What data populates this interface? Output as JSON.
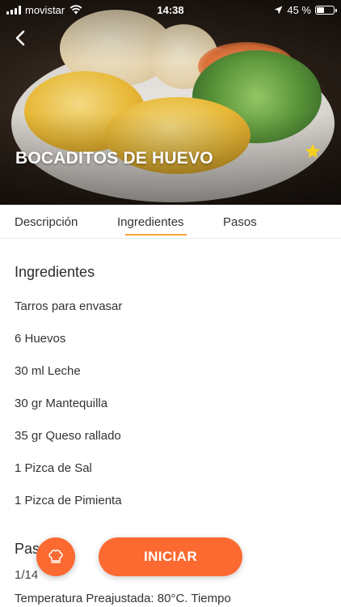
{
  "status_bar": {
    "carrier": "movistar",
    "time": "14:38",
    "battery": "45 %",
    "battery_level": 0.45
  },
  "recipe": {
    "title": "BOCADITOS DE HUEVO"
  },
  "tabs": [
    {
      "label": "Descripción",
      "active": false
    },
    {
      "label": "Ingredientes",
      "active": true
    },
    {
      "label": "Pasos",
      "active": false
    }
  ],
  "ingredients": {
    "title": "Ingredientes",
    "items": [
      "Tarros para envasar",
      "6 Huevos",
      "30 ml Leche",
      "30 gr Mantequilla",
      "35 gr Queso rallado",
      "1 Pizca de Sal",
      "1 Pizca de Pimienta"
    ]
  },
  "steps": {
    "title": "Pasos",
    "counter": "1/14",
    "text": "Temperatura Preajustada: 80°C. Tiempo"
  },
  "actions": {
    "start_label": "INICIAR",
    "chef_icon": "chef-hat-icon"
  },
  "colors": {
    "accent": "#fc6a31",
    "tab_underline": "#f2a33a",
    "star": "#f5d020"
  }
}
